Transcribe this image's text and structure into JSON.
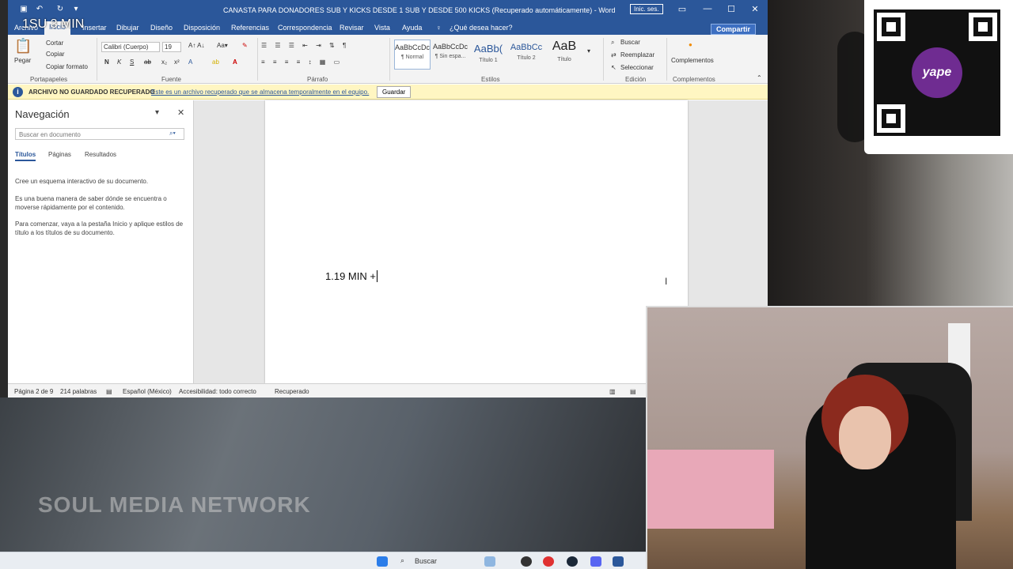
{
  "window": {
    "title": "CANASTA PARA DONADORES SUB Y KICKS DESDE 1 SUB Y DESDE 500 KICKS (Recuperado automáticamente) - Word",
    "sign_in": "Inic. ses.",
    "minimize": "—",
    "maximize": "☐",
    "close": "✕"
  },
  "overlay_text": "1SU   3 MIN",
  "menu": {
    "archivo": "Archivo",
    "tabs": [
      "Inicio",
      "Insertar",
      "Dibujar",
      "Diseño",
      "Disposición",
      "Referencias",
      "Correspondencia",
      "Revisar",
      "Vista",
      "Ayuda"
    ],
    "tell_me": "¿Qué desea hacer?",
    "share": "Compartir"
  },
  "ribbon": {
    "paste": "Pegar",
    "cut": "Cortar",
    "copy": "Copiar",
    "copy_format": "Copiar formato",
    "clipboard": "Portapapeles",
    "font_name": "Calibri (Cuerpo)",
    "font_size": "19",
    "font_group": "Fuente",
    "paragraph_group": "Párrafo",
    "styles_group": "Estilos",
    "styles": [
      {
        "preview": "AaBbCcDc",
        "label": "¶ Normal"
      },
      {
        "preview": "AaBbCcDc",
        "label": "¶ Sin espa..."
      },
      {
        "preview": "AaBb(",
        "label": "Título 1"
      },
      {
        "preview": "AaBbCc",
        "label": "Título 2"
      },
      {
        "preview": "AaB",
        "label": "Título"
      }
    ],
    "find": "Buscar",
    "replace": "Reemplazar",
    "select": "Seleccionar",
    "editing_group": "Edición",
    "addins": "Complementos",
    "addins_group": "Complementos"
  },
  "infobar": {
    "title": "ARCHIVO NO GUARDADO RECUPERADO",
    "message": "Este es un archivo recuperado que se almacena temporalmente en el equipo.",
    "save": "Guardar"
  },
  "nav": {
    "title": "Navegación",
    "search_placeholder": "Buscar en documento",
    "tabs": [
      "Títulos",
      "Páginas",
      "Resultados"
    ],
    "p1": "Cree un esquema interactivo de su documento.",
    "p2": "Es una buena manera de saber dónde se encuentra o moverse rápidamente por el contenido.",
    "p3": "Para comenzar, vaya a la pestaña Inicio y aplique estilos de título a los títulos de su documento."
  },
  "document": {
    "text": "1.19 MIN +"
  },
  "status": {
    "page": "Página 2 de 9",
    "words": "214 palabras",
    "language": "Español (México)",
    "accessibility": "Accesibilidad: todo correcto",
    "recovered": "Recuperado"
  },
  "qr": {
    "brand": "yape"
  },
  "video": {
    "watermark": "SOUL MEDIA NETWORK"
  },
  "taskbar": {
    "search": "Buscar"
  },
  "colors": {
    "word_blue": "#2b579a",
    "info_yellow": "#fff6c2",
    "yape_purple": "#6f2c91"
  }
}
